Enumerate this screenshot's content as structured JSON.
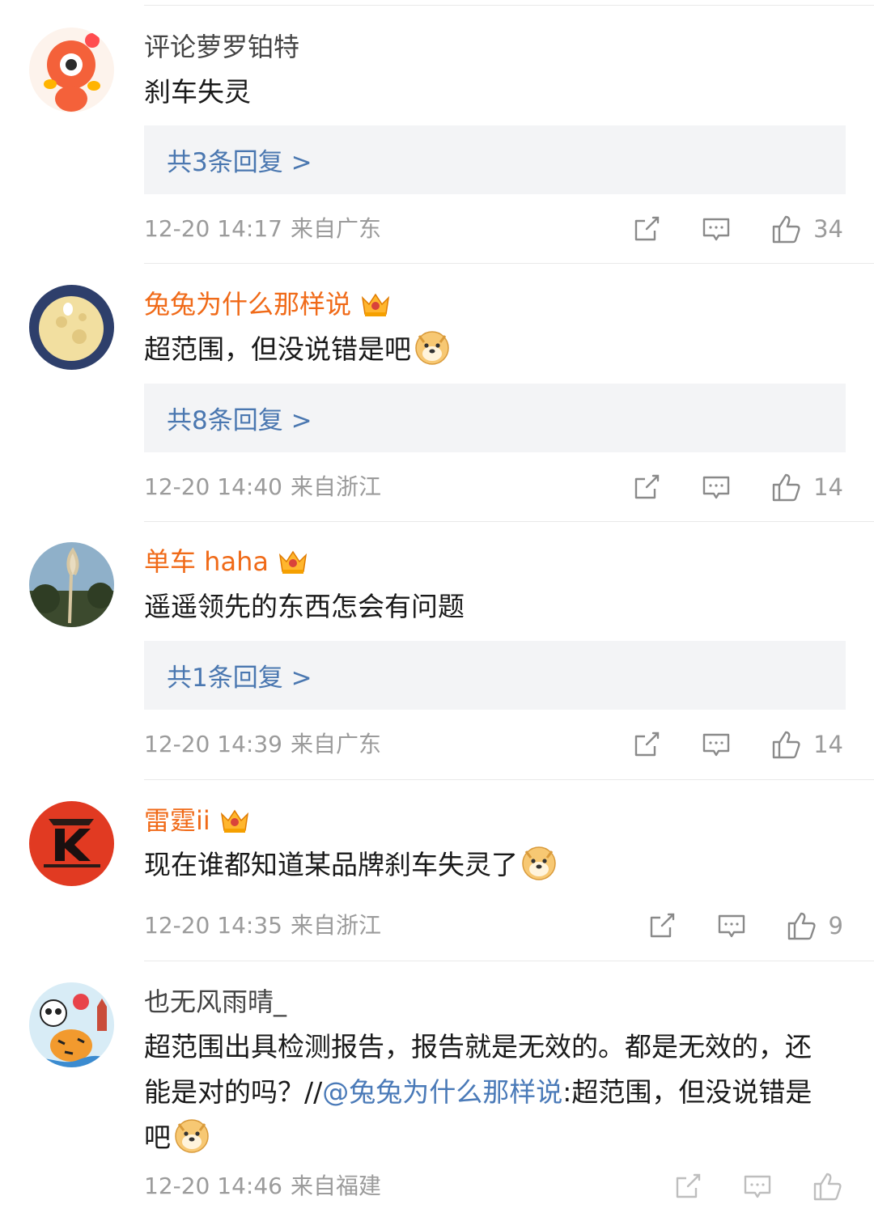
{
  "comments": [
    {
      "user": "评论萝罗铂特",
      "text": "刹车失灵",
      "replies_label": "共3条回复 >",
      "time": "12-20 14:17",
      "location": "来自广东",
      "likes": "34"
    },
    {
      "user": "兔兔为什么那样说",
      "text": "超范围，但没说错是吧",
      "replies_label": "共8条回复 >",
      "time": "12-20 14:40",
      "location": "来自浙江",
      "likes": "14"
    },
    {
      "user": "单车 haha",
      "text": "遥遥领先的东西怎会有问题",
      "replies_label": "共1条回复 >",
      "time": "12-20 14:39",
      "location": "来自广东",
      "likes": "14"
    },
    {
      "user": "雷霆ii",
      "text": "现在谁都知道某品牌刹车失灵了",
      "time": "12-20 14:35",
      "location": "来自浙江",
      "likes": "9"
    },
    {
      "user": "也无风雨晴_",
      "text_before": "超范围出具检测报告，报告就是无效的。都是无效的，还能是对的吗？//",
      "mention": "@兔兔为什么那样说",
      "text_after": ":超范围，但没说错是吧",
      "time": "12-20 14:46",
      "location": "来自福建"
    }
  ],
  "icons": {
    "repost": "repost-icon",
    "comment": "comment-icon",
    "like": "like-icon",
    "emoji": "doge-emoji-icon",
    "crown": "vip-crown-icon"
  },
  "colors": {
    "vip_name": "#f06a18",
    "link": "#4a77b0",
    "meta": "#9b9b9b",
    "reply_bg": "#f3f4f6"
  }
}
